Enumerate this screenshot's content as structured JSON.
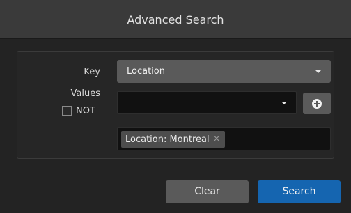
{
  "dialog": {
    "title": "Advanced Search"
  },
  "form": {
    "key_label": "Key",
    "key_value": "Location",
    "values_label": "Values",
    "not_label": "NOT",
    "not_checked": false,
    "values_input_value": "",
    "tags": [
      {
        "label": "Location: Montreal",
        "remove_icon": "×"
      }
    ]
  },
  "buttons": {
    "clear_label": "Clear",
    "search_label": "Search"
  },
  "icons": {
    "key_dropdown": "chevron-down-icon",
    "values_dropdown": "chevron-down-icon",
    "add_value": "plus-circle-icon",
    "remove_tag": "close-icon"
  },
  "colors": {
    "primary_button": "#1565b0",
    "secondary_button": "#5a5a5a"
  }
}
